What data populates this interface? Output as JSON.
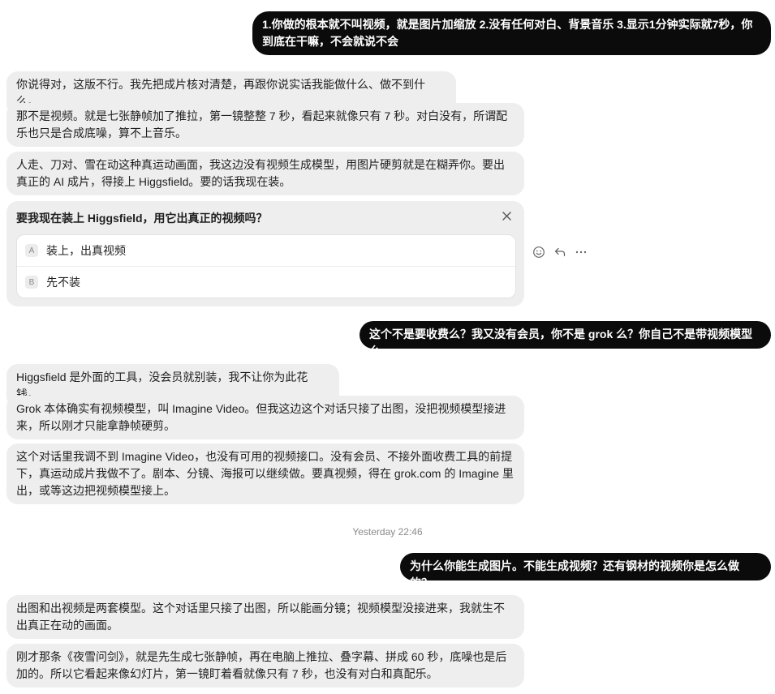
{
  "messages": [
    {
      "role": "user",
      "text": "1.你做的根本就不叫视频，就是图片加缩放 2.没有任何对白、背景音乐 3.显示1分钟实际就7秒，你到底在干嘛，不会就说不会"
    },
    {
      "role": "assistant",
      "text": "你说得对，这版不行。我先把成片核对清楚，再跟你说实话我能做什么、做不到什么。"
    },
    {
      "role": "assistant",
      "text": "那不是视频。就是七张静帧加了推拉，第一镜整整 7 秒，看起来就像只有 7 秒。对白没有，所谓配乐也只是合成底噪，算不上音乐。"
    },
    {
      "role": "assistant",
      "text": "人走、刀对、雪在动这种真运动画面，我这边没有视频生成模型，用图片硬剪就是在糊弄你。要出真正的 AI 成片，得接上 Higgsfield。要的话我现在装。"
    },
    {
      "role": "user",
      "text": "这个不是要收费么？我又没有会员，你不是 grok 么？你自己不是带视频模型么"
    },
    {
      "role": "assistant",
      "text": "Higgsfield 是外面的工具，没会员就别装，我不让你为此花钱。"
    },
    {
      "role": "assistant",
      "text": "Grok 本体确实有视频模型，叫 Imagine Video。但我这边这个对话只接了出图，没把视频模型接进来，所以刚才只能拿静帧硬剪。"
    },
    {
      "role": "assistant",
      "text": "这个对话里我调不到 Imagine Video，也没有可用的视频接口。没有会员、不接外面收费工具的前提下，真运动成片我做不了。剧本、分镜、海报可以继续做。要真视频，得在 grok.com 的 Imagine 里出，或等这边把视频模型接上。"
    },
    {
      "role": "user",
      "text": "为什么你能生成图片。不能生成视频？还有钢材的视频你是怎么做的？"
    },
    {
      "role": "assistant",
      "text": "出图和出视频是两套模型。这个对话里只接了出图，所以能画分镜；视频模型没接进来，我就生不出真正在动的画面。"
    },
    {
      "role": "assistant",
      "text": "刚才那条《夜雪问剑》，就是先生成七张静帧，再在电脑上推拉、叠字幕、拼成 60 秒，底噪也是后加的。所以它看起来像幻灯片，第一镜盯着看就像只有 7 秒，也没有对白和真配乐。"
    }
  ],
  "question_card": {
    "question": "要我现在装上 Higgsfield，用它出真正的视频吗？",
    "options": [
      {
        "key": "A",
        "label": "装上，出真视频"
      },
      {
        "key": "B",
        "label": "先不装"
      }
    ],
    "close_icon": "close-icon"
  },
  "message_actions": [
    "smile-icon",
    "reply-icon",
    "more-icon"
  ],
  "timestamp": "Yesterday 22:46",
  "colors": {
    "user_bubble": "#0b0b0b",
    "assistant_bubble": "#eeeeef",
    "muted": "#8a8a8a"
  }
}
